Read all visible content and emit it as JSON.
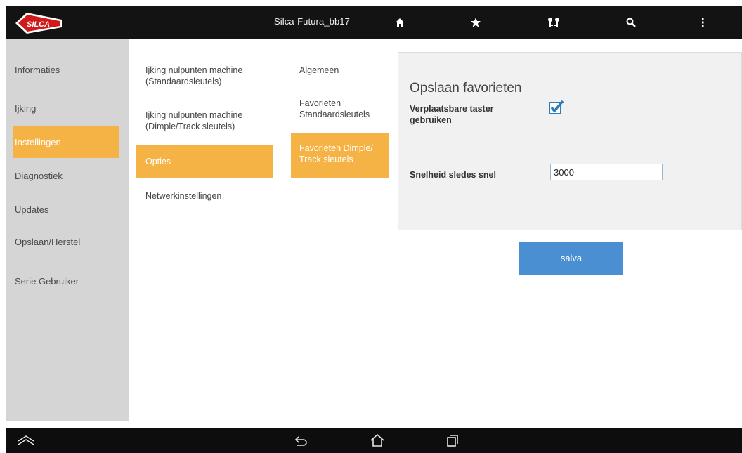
{
  "header": {
    "logo_text": "SILCA",
    "title": "Silca-Futura_bb17",
    "icons": [
      "home-icon",
      "star-icon",
      "keys-icon",
      "search-icon",
      "more-vert-icon"
    ]
  },
  "sidebar": {
    "items": [
      {
        "label": "Informaties"
      },
      {
        "label": "Ijking"
      },
      {
        "label": "Instellingen"
      },
      {
        "label": "Diagnostiek"
      },
      {
        "label": "Updates"
      },
      {
        "label": "Opslaan/Herstel"
      },
      {
        "label": "Serie Gebruiker"
      }
    ]
  },
  "column1": {
    "items": [
      {
        "label": "Ijking nulpunten machine (Standaardsleutels)"
      },
      {
        "label": "Ijking nulpunten machine (Dimple/Track sleutels)"
      },
      {
        "label": "Opties"
      },
      {
        "label": "Netwerkinstellingen"
      }
    ]
  },
  "column2": {
    "items": [
      {
        "label": "Algemeen"
      },
      {
        "label": "Favorieten Standaardsleutels"
      },
      {
        "label": "Favorieten Dimple/ Track sleutels"
      }
    ]
  },
  "panel": {
    "title": "Opslaan favorieten",
    "movable_probe_label": "Verplaatsbare taster gebruiken",
    "movable_probe_checked": true,
    "speed_label": "Snelheid sledes snel",
    "speed_value": "3000"
  },
  "save_button": {
    "label": "salva"
  },
  "colors": {
    "accent": "#f5b345",
    "button": "#4a8fd1",
    "topbar": "#131313",
    "sidebar": "#d5d5d5"
  },
  "navbar": {
    "icons": [
      "home-up-icon",
      "back-icon",
      "home-icon",
      "recent-apps-icon"
    ]
  }
}
